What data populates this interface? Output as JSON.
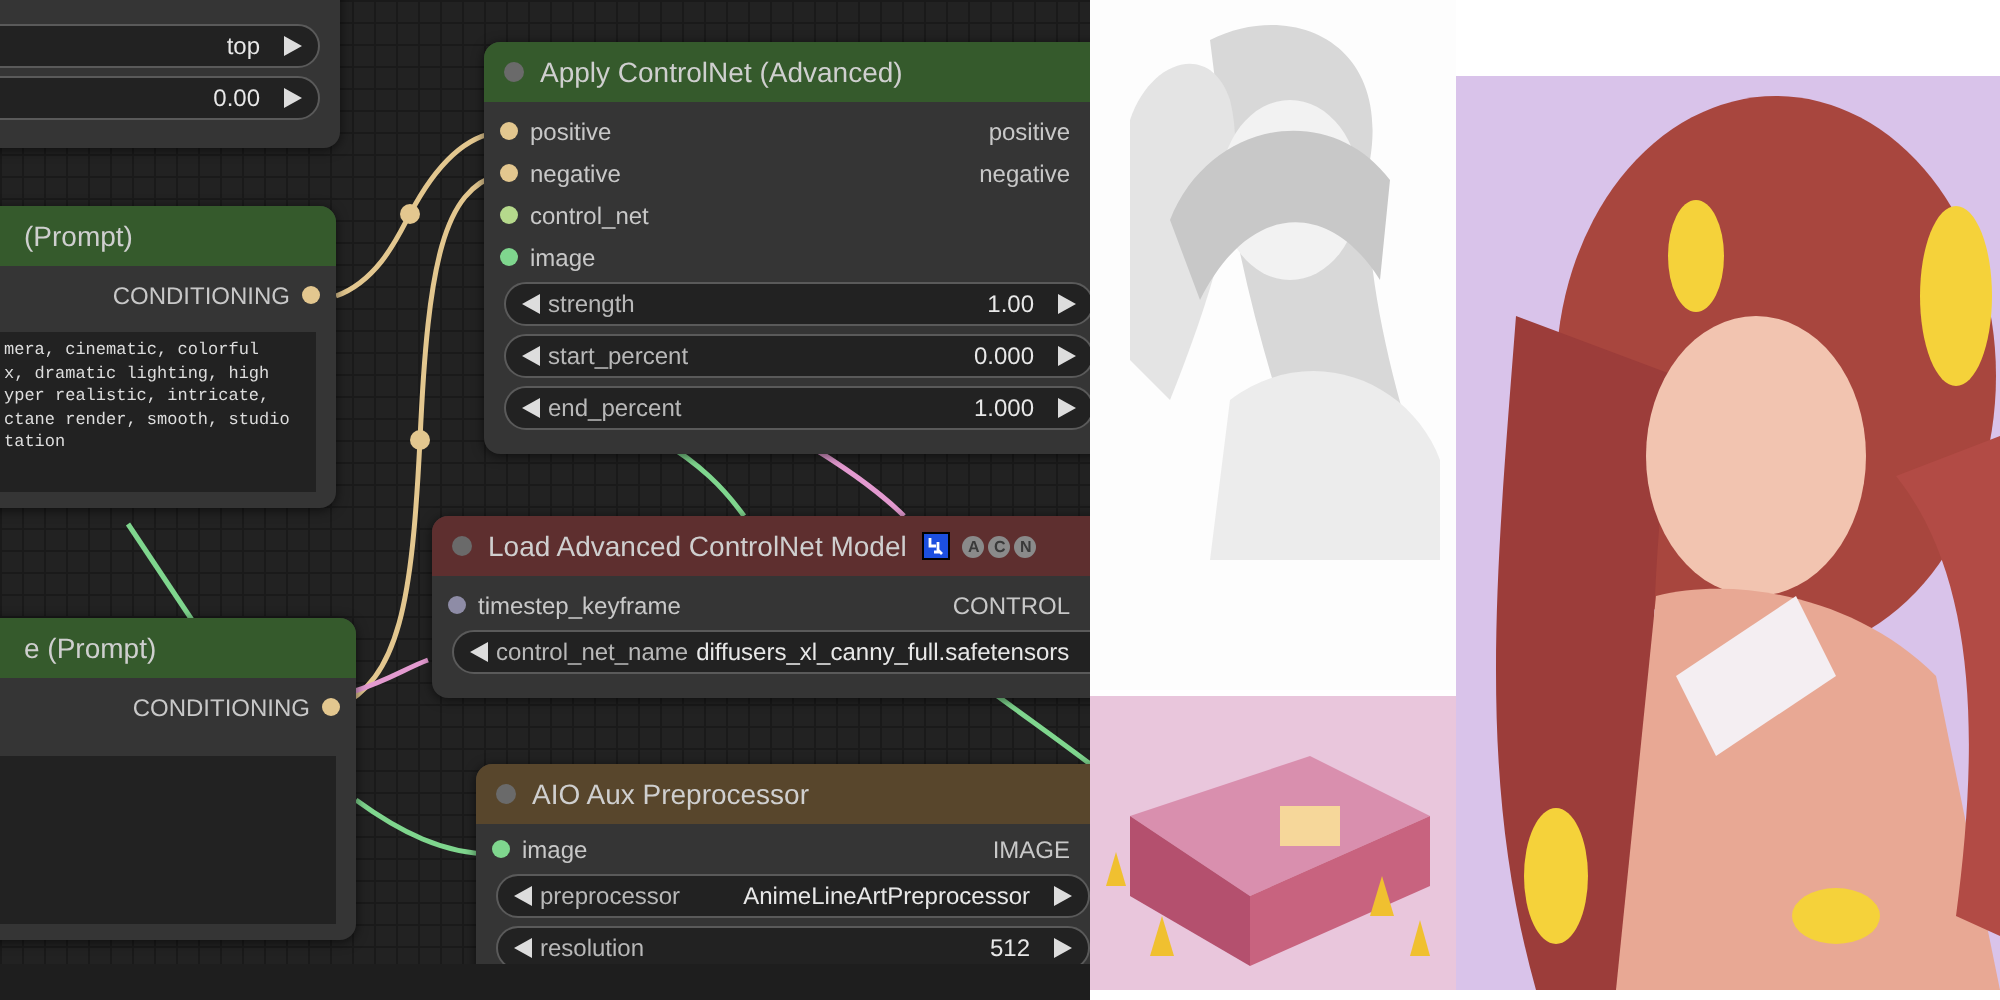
{
  "nodes": [
    {
      "kind": "node",
      "widgets": [
        {
          "value": "top"
        },
        {
          "value": "0.00"
        }
      ]
    },
    {
      "kind": "prompt",
      "title": "(Prompt)",
      "color": "#355a2c",
      "outputs": [
        {
          "label": "CONDITIONING",
          "color": "#e3c78f"
        }
      ],
      "text_lines": [
        "mera, cinematic, colorful",
        "x, dramatic lighting, high",
        "yper realistic, intricate,",
        "ctane render, smooth, studio",
        "tation"
      ]
    },
    {
      "kind": "prompt",
      "title": "e (Prompt)",
      "color": "#355a2c",
      "outputs": [
        {
          "label": "CONDITIONING",
          "color": "#e3c78f"
        }
      ]
    },
    {
      "kind": "node",
      "title": "Apply ControlNet (Advanced)",
      "color": "#355a2c",
      "inputs": [
        {
          "label": "positive",
          "color": "#e3c78f"
        },
        {
          "label": "negative",
          "color": "#e3c78f"
        },
        {
          "label": "control_net",
          "color": "#b5d98c"
        },
        {
          "label": "image",
          "color": "#7fd68e"
        }
      ],
      "outputs": [
        {
          "label": "positive"
        },
        {
          "label": "negative"
        }
      ],
      "widgets": [
        {
          "label": "strength",
          "value": "1.00"
        },
        {
          "label": "start_percent",
          "value": "0.000"
        },
        {
          "label": "end_percent",
          "value": "1.000"
        }
      ]
    },
    {
      "kind": "node",
      "title": "Load Advanced ControlNet Model",
      "color": "#5e2f2f",
      "badges": [
        "A",
        "C",
        "N"
      ],
      "inputs": [
        {
          "label": "timestep_keyframe",
          "color": "#8e8ca6"
        }
      ],
      "outputs": [
        {
          "label": "CONTROL"
        }
      ],
      "widgets": [
        {
          "label": "control_net_name",
          "value": "diffusers_xl_canny_full.safetensors"
        }
      ]
    },
    {
      "kind": "node",
      "title": "AIO Aux Preprocessor",
      "color": "#58462c",
      "inputs": [
        {
          "label": "image",
          "color": "#7fd68e"
        }
      ],
      "outputs": [
        {
          "label": "IMAGE"
        }
      ],
      "widgets": [
        {
          "label": "preprocessor",
          "value": "AnimeLineArtPreprocessor"
        },
        {
          "label": "resolution",
          "value": "512"
        }
      ]
    }
  ]
}
